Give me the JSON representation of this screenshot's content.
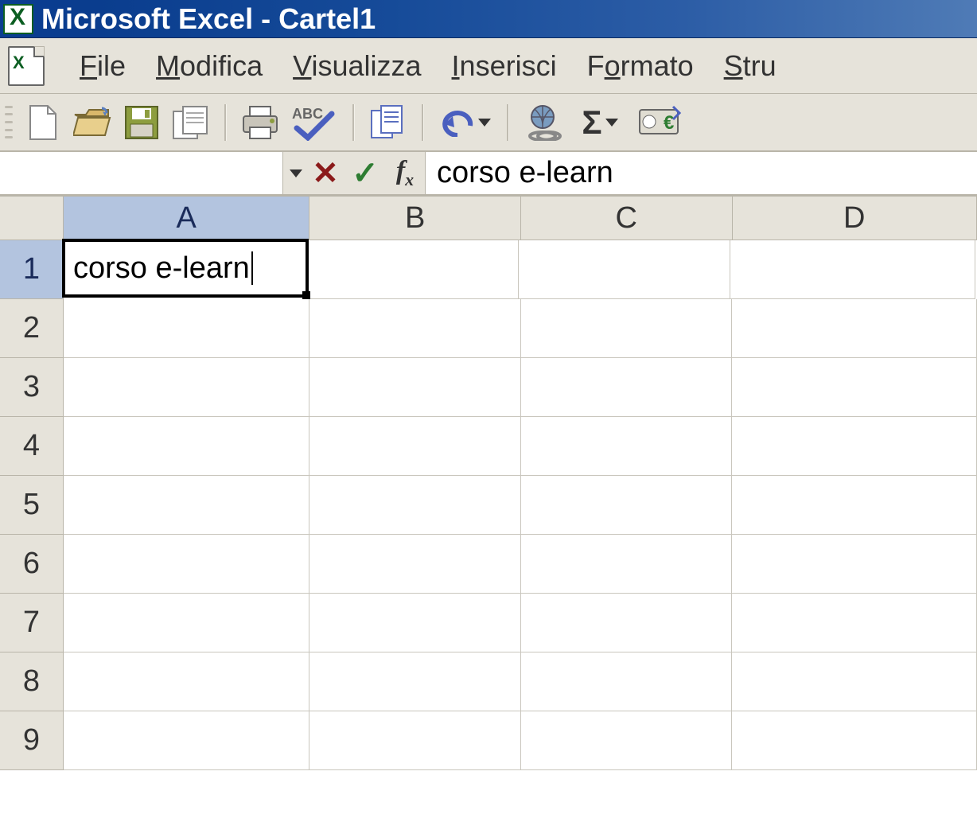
{
  "titlebar": {
    "title": "Microsoft Excel - Cartel1"
  },
  "menu": {
    "file": "File",
    "modifica": "Modifica",
    "visualizza": "Visualizza",
    "inserisci": "Inserisci",
    "formato": "Formato",
    "strumenti": "Stru"
  },
  "toolbar_icons": {
    "new": "new-document-icon",
    "open": "open-folder-icon",
    "save": "save-icon",
    "permission": "permission-icon",
    "print": "print-icon",
    "spelling": "spelling-icon",
    "copy": "copy-icon",
    "undo": "undo-icon",
    "hyperlink": "hyperlink-icon",
    "sum": "autosum-icon",
    "currency": "currency-icon"
  },
  "formulabar": {
    "namebox": "",
    "formula": "corso e-learn"
  },
  "columns": [
    "A",
    "B",
    "C",
    "D"
  ],
  "rows": [
    "1",
    "2",
    "3",
    "4",
    "5",
    "6",
    "7",
    "8",
    "9"
  ],
  "selected_cell": "A1",
  "cells": {
    "A1": "corso e-learn"
  }
}
